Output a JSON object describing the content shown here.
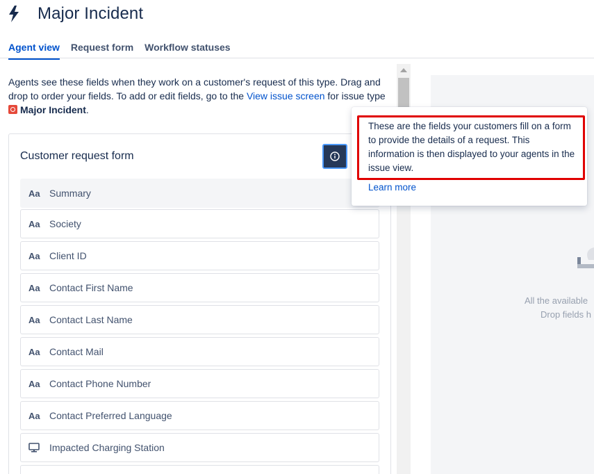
{
  "header": {
    "title": "Major Incident",
    "icon": "lightning-bolt-icon"
  },
  "tabs": [
    {
      "label": "Agent view",
      "active": true
    },
    {
      "label": "Request form",
      "active": false
    },
    {
      "label": "Workflow statuses",
      "active": false
    }
  ],
  "description": {
    "text_before_link": "Agents see these fields when they work on a customer's request of this type. Drag and drop to order your fields. To add or edit fields, go to the ",
    "link": "View issue screen",
    "text_after_link": " for issue type ",
    "issue_type": "Major Incident",
    "end": "."
  },
  "card": {
    "title": "Customer request form",
    "fields": [
      {
        "label": "Summary",
        "icon": "Aa"
      },
      {
        "label": "Society",
        "icon": "Aa"
      },
      {
        "label": "Client ID",
        "icon": "Aa"
      },
      {
        "label": "Contact First Name",
        "icon": "Aa"
      },
      {
        "label": "Contact Last Name",
        "icon": "Aa"
      },
      {
        "label": "Contact Mail",
        "icon": "Aa"
      },
      {
        "label": "Contact Phone Number",
        "icon": "Aa"
      },
      {
        "label": "Contact Preferred Language",
        "icon": "Aa"
      },
      {
        "label": "Impacted Charging Station",
        "icon": "monitor-icon"
      }
    ]
  },
  "popup": {
    "text": "These are the fields your customers fill on a form to provide the details of a request. This information is then displayed to your agents in the issue view.",
    "link": "Learn more"
  },
  "right_panel": {
    "line1": "All the available",
    "line2": "Drop fields h"
  },
  "colors": {
    "accent": "#0052cc",
    "info_button": "#253858",
    "highlight": "#e00000",
    "issue_type": "#e5493a"
  }
}
